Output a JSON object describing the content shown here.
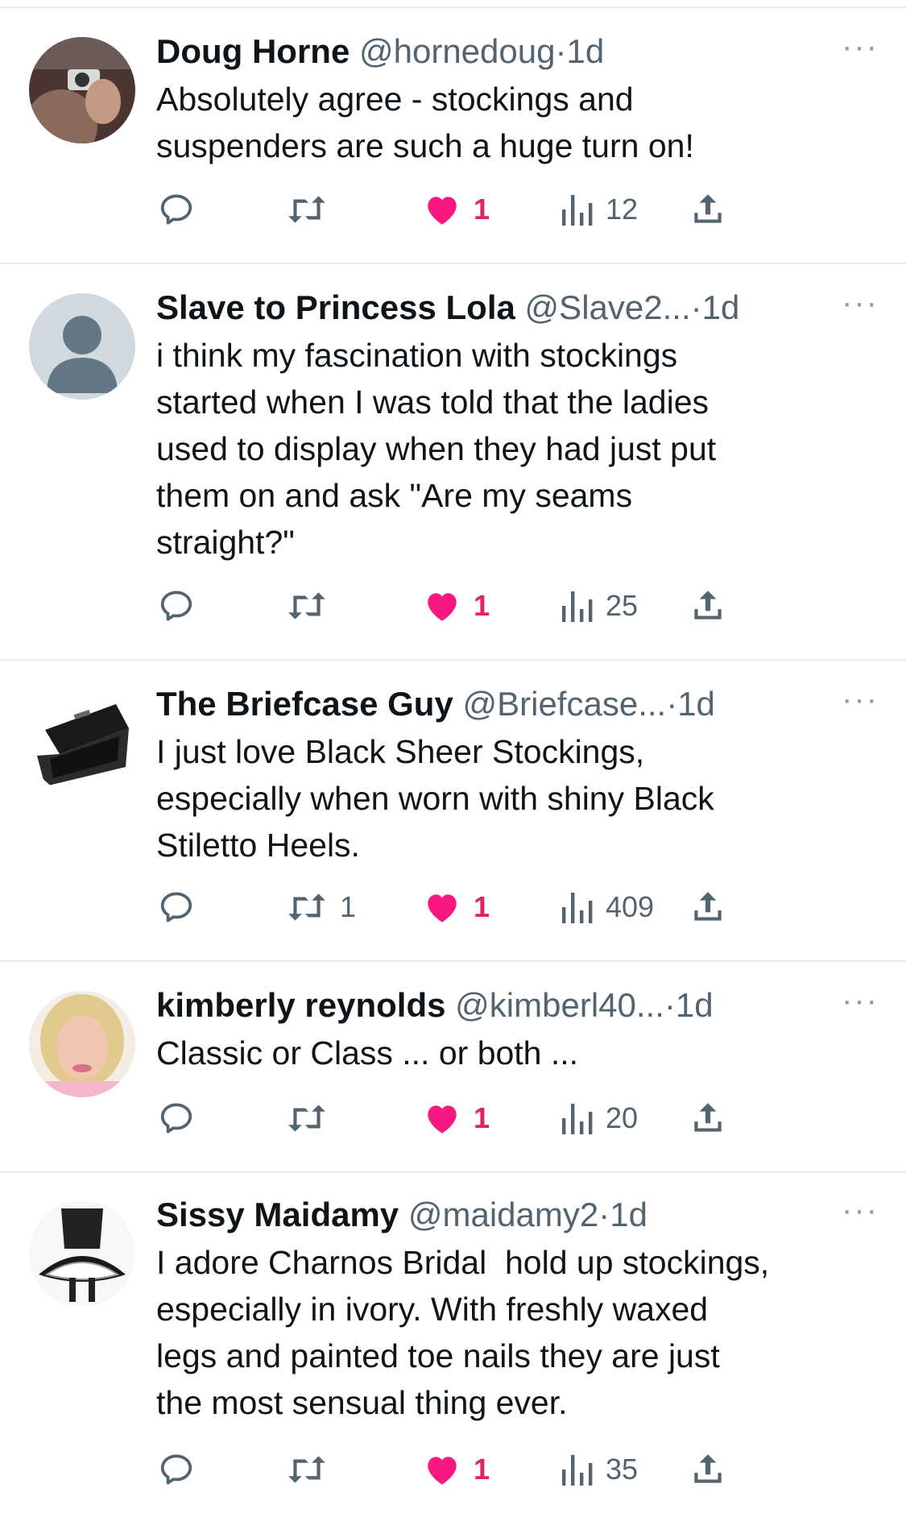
{
  "colors": {
    "like": "#f91880",
    "icon": "#536471",
    "divider": "#e7e9ea"
  },
  "tweets": [
    {
      "name": "Doug Horne",
      "handle": "@hornedoug",
      "separator": "·",
      "time": "1d",
      "text": "Absolutely agree - stockings and\nsuspenders are such a huge turn on!",
      "replies": "",
      "retweets": "",
      "likes": "1",
      "views": "12",
      "avatar": "photo-camera-mirror-selfie"
    },
    {
      "name": "Slave to Princess Lola",
      "handle": "@Slave2...",
      "separator": "·",
      "time": "1d",
      "text": "i think my fascination with stockings\nstarted when I was told that the ladies\nused to display when they had just put\nthem on and ask \"Are my seams\nstraight?\"",
      "replies": "",
      "retweets": "",
      "likes": "1",
      "views": "25",
      "avatar": "default-profile"
    },
    {
      "name": "The Briefcase Guy",
      "handle": "@Briefcase...",
      "separator": "·",
      "time": "1d",
      "text": "I just love Black Sheer Stockings,\nespecially when worn with shiny Black\nStiletto Heels.",
      "replies": "",
      "retweets": "1",
      "likes": "1",
      "views": "409",
      "avatar": "open-briefcase"
    },
    {
      "name": "kimberly reynolds",
      "handle": "@kimberl40...",
      "separator": "·",
      "time": "1d",
      "text": "Classic or Class ... or both ...",
      "replies": "",
      "retweets": "",
      "likes": "1",
      "views": "20",
      "avatar": "blonde-person"
    },
    {
      "name": "Sissy Maidamy",
      "handle": "@maidamy2",
      "separator": "·",
      "time": "1d",
      "text": "I adore Charnos Bridal  hold up stockings,\nespecially in ivory. With freshly waxed\nlegs and painted toe nails they are just\nthe most sensual thing ever.",
      "replies": "",
      "retweets": "",
      "likes": "1",
      "views": "35",
      "avatar": "maid-outfit"
    }
  ],
  "more_label": "···"
}
